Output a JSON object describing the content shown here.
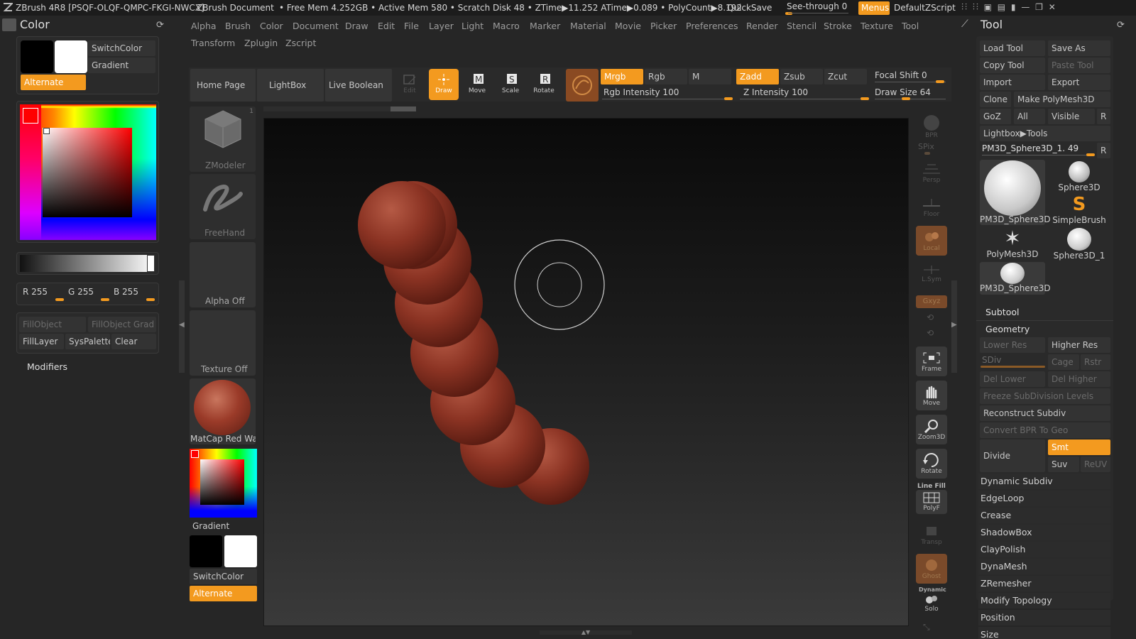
{
  "titlebar": {
    "app": "ZBrush 4R8 [PSQF-OLQF-QMPC-FKGI-NWCX]",
    "doc": "ZBrush Document",
    "stats": "• Free Mem 4.252GB • Active Mem 580 • Scratch Disk 48 •  ZTime▶11.252 ATime▶0.089 • PolyCount▶8.192",
    "quicksave": "QuickSave",
    "seethrough": "See-through  0",
    "menus": "Menus",
    "script": "DefaultZScript"
  },
  "menubar": {
    "row1": [
      "Alpha",
      "Brush",
      "Color",
      "Document",
      "Draw",
      "Edit",
      "File",
      "Layer",
      "Light",
      "Macro",
      "Marker",
      "Material",
      "Movie",
      "Picker",
      "Preferences",
      "Render",
      "Stencil",
      "Stroke",
      "Texture",
      "Tool"
    ],
    "row2": [
      "Transform",
      "Zplugin",
      "Zscript"
    ]
  },
  "color_panel": {
    "title": "Color",
    "switch_color": "SwitchColor",
    "gradient": "Gradient",
    "alternate": "Alternate",
    "r": "R 255",
    "g": "G 255",
    "b": "B 255",
    "fill_object": "FillObject",
    "fill_object_grad": "FillObject Grad",
    "fill_layer": "FillLayer",
    "sys_palette": "SysPalette",
    "clear": "Clear",
    "modifiers": "Modifiers"
  },
  "tray": {
    "zmodeler": "ZModeler",
    "zmodeler_count": "1",
    "freehand": "FreeHand",
    "alpha_off": "Alpha Off",
    "texture_off": "Texture Off",
    "material": "MatCap Red Wax",
    "gradient": "Gradient",
    "switch_color": "SwitchColor",
    "alternate": "Alternate"
  },
  "toolbar": {
    "home_page": "Home Page",
    "lightbox": "LightBox",
    "live_boolean": "Live Boolean",
    "edit": "Edit",
    "draw": "Draw",
    "move": "Move",
    "scale": "Scale",
    "rotate": "Rotate",
    "mrgb": "Mrgb",
    "rgb": "Rgb",
    "m": "M",
    "zadd": "Zadd",
    "zsub": "Zsub",
    "zcut": "Zcut",
    "rgb_intensity": "Rgb Intensity 100",
    "z_intensity": "Z Intensity 100",
    "focal_shift": "Focal Shift 0",
    "draw_size": "Draw Size 64"
  },
  "right_shelf": {
    "bpr": "BPR",
    "spix": "SPix",
    "persp": "Persp",
    "floor": "Floor",
    "local": "Local",
    "lsym": "L.Sym",
    "xyz": "Gxyz",
    "frame": "Frame",
    "move": "Move",
    "zoom3d": "Zoom3D",
    "rotate": "Rotate",
    "linefill": "Line Fill",
    "polyf": "PolyF",
    "transp": "Transp",
    "ghost": "Ghost",
    "dynamic": "Dynamic",
    "solo": "Solo"
  },
  "tool_panel": {
    "title": "Tool",
    "load_tool": "Load Tool",
    "save_as": "Save As",
    "copy_tool": "Copy Tool",
    "paste_tool": "Paste Tool",
    "import": "Import",
    "export": "Export",
    "clone": "Clone",
    "make_polymesh": "Make PolyMesh3D",
    "goz": "GoZ",
    "all": "All",
    "visible": "Visible",
    "r": "R",
    "lightbox_tools": "Lightbox▶Tools",
    "current_tool": "PM3D_Sphere3D_1. 49",
    "tools": [
      "PM3D_Sphere3D",
      "Sphere3D",
      "SimpleBrush",
      "PolyMesh3D",
      "Sphere3D_1",
      "PM3D_Sphere3D"
    ],
    "subtool": "Subtool",
    "geometry": "Geometry",
    "lower_res": "Lower Res",
    "higher_res": "Higher Res",
    "sdiv": "SDiv",
    "cage": "Cage",
    "rstr": "Rstr",
    "del_lower": "Del Lower",
    "del_higher": "Del Higher",
    "freeze": "Freeze SubDivision Levels",
    "reconstruct": "Reconstruct Subdiv",
    "convert_bpr": "Convert BPR To Geo",
    "divide": "Divide",
    "smt": "Smt",
    "suv": "Suv",
    "reuv": "ReUV",
    "sections": [
      "Dynamic Subdiv",
      "EdgeLoop",
      "Crease",
      "ShadowBox",
      "ClayPolish",
      "DynaMesh",
      "ZRemesher",
      "Modify Topology",
      "Position",
      "Size"
    ]
  },
  "colors": {
    "accent": "#f39a1f",
    "panel": "#262626",
    "button": "#333333",
    "wax": "#8e3524"
  }
}
